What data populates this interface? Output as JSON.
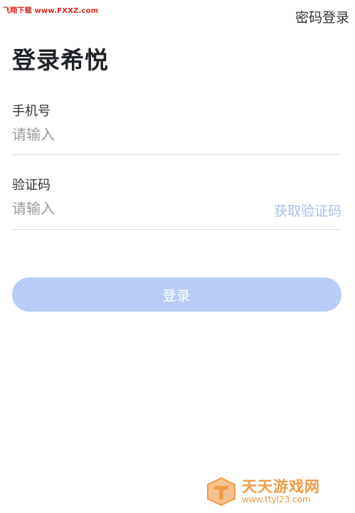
{
  "watermark_top": "飞翔下载 www.FXXZ.com",
  "header": {
    "password_login_link": "密码登录"
  },
  "title": "登录希悦",
  "phone_field": {
    "label": "手机号",
    "placeholder": "请输入"
  },
  "code_field": {
    "label": "验证码",
    "placeholder": "请输入",
    "get_code_label": "获取验证码"
  },
  "login_button": {
    "label": "登录"
  },
  "bottom_watermark": {
    "name": "天天游戏网",
    "url": "www.ttyl23.com"
  },
  "colors": {
    "accent_disabled": "#b9cdf6",
    "link_disabled": "#a8bfeb",
    "watermark_orange": "#f19a45",
    "watermark_red": "#e0241c"
  }
}
